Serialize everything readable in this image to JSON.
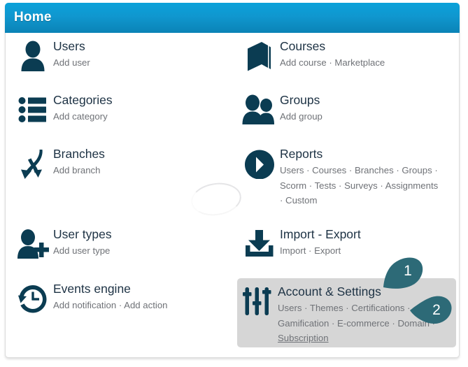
{
  "header": {
    "title": "Home",
    "accent_color": "#1097cf"
  },
  "panel": {
    "highlight_bg": "#d6d6d6",
    "icon_color": "#0b3c52",
    "title_color": "#1d3244",
    "subtitle_color": "#6f7277"
  },
  "tiles": {
    "users": {
      "title": "Users",
      "icon": "user-icon",
      "sub": "Add user"
    },
    "categories": {
      "title": "Categories",
      "icon": "list-icon",
      "sub": "Add category"
    },
    "branches": {
      "title": "Branches",
      "icon": "branches-icon",
      "sub": "Add branch"
    },
    "usertypes": {
      "title": "User types",
      "icon": "user-plus-icon",
      "sub": "Add user type"
    },
    "events": {
      "title": "Events engine",
      "icon": "clock-back-icon",
      "sub": "Add notification · Add action"
    },
    "courses": {
      "title": "Courses",
      "icon": "book-icon",
      "sub": "Add course · Marketplace"
    },
    "groups": {
      "title": "Groups",
      "icon": "group-icon",
      "sub": "Add group"
    },
    "reports": {
      "title": "Reports",
      "icon": "pie-chart-icon",
      "sub_line1": "Users · Courses · Branches · Groups ·",
      "sub_line2": "Scorm · Tests · Surveys · Assignments",
      "sub_line3": "· Custom"
    },
    "import": {
      "title": "Import - Export",
      "icon": "download-icon",
      "sub": "Import · Export"
    },
    "account": {
      "title": "Account & Settings",
      "icon": "sliders-icon",
      "sub_line1": "Users · Themes · Certifications ·",
      "sub_line2": "Gamification · E-commerce · Domain ·",
      "sub_line3": "Subscription"
    }
  },
  "annotations": {
    "pin_color": "#2d6a77",
    "items": [
      {
        "label": "1"
      },
      {
        "label": "2"
      }
    ]
  }
}
